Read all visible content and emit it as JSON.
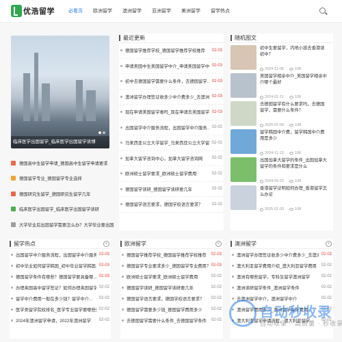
{
  "logo": {
    "text": "优浩留学"
  },
  "nav": [
    "必看页",
    "欧洲留学",
    "澳洲留学",
    "亚洲留学",
    "美洲留学",
    "留学热点"
  ],
  "hero": {
    "caption": "临床医学出国留学_临床医学出国留学读博"
  },
  "left_list": [
    {
      "text": "德国高中生留学申请_德国高中生留学申请要求",
      "color": "#e86a4a"
    },
    {
      "text": "德国留学专业_德国留学专业选择",
      "color": "#f2a43a"
    },
    {
      "text": "德国研究生留学_德国研究生留学几年",
      "color": "#e86a4a"
    },
    {
      "text": "临床医学出国留学_临床医学出国留学读研",
      "color": "#4caf50"
    },
    {
      "text": "大学毕业后出国留学需要怎么办？大学毕业要出国留学...",
      "color": "#9e9e9e"
    }
  ],
  "latest": {
    "title": "最近更新",
    "items": [
      {
        "text": "德国留学推荐学校_德国留学推荐学校推荐",
        "date": "02-03",
        "red": true
      },
      {
        "text": "申请美国中生美国留学中介_申请美国留学中介...",
        "date": "02-03",
        "red": true
      },
      {
        "text": "初中去德国留学需要什么条件，去德国留学...",
        "date": "02-03",
        "red": true
      },
      {
        "text": "澳洲留学办理签证收多少中介费多少_去澳洲...",
        "date": "02-03",
        "red": true
      },
      {
        "text": "现在申请美国留学难吗_现在申请去美国留学难...",
        "date": "02-03",
        "red": true
      },
      {
        "text": "出国留学中介服务流程，出国留学中介服务...",
        "date": "02-02",
        "red": false
      },
      {
        "text": "马来西亚公立大学留学_马来西亚公立大学留...",
        "date": "02-02",
        "red": false
      },
      {
        "text": "加拿大留学咨询中心，加拿大留学咨询网",
        "date": "02-02",
        "red": false
      },
      {
        "text": "欧洲硕士留学要求_欧洲硕士留学费用",
        "date": "02-02",
        "red": false
      },
      {
        "text": "德国留学读研_德国留学读研要几年",
        "date": "02-02",
        "red": false
      },
      {
        "text": "德国留学语言要求，德国学校语言要求？",
        "date": "02-02",
        "red": false
      }
    ]
  },
  "random": {
    "title": "随机图文",
    "items": [
      {
        "title": "初中生要留学，内地小孩去香港读初中？",
        "date": "2024-11-08",
        "views": "108",
        "color": "#d8c5b4"
      },
      {
        "title": "美国留学相亲中介_美国留学相亲中介哪个最好",
        "date": "2024-01-11",
        "views": "108",
        "color": "#b8c2cc"
      },
      {
        "title": "去德国留学有什么要求吗，去德国留学，需要什么条件？",
        "date": "2025-01-06",
        "views": "108",
        "color": "#cfd8c7"
      },
      {
        "title": "留学韩国中介费，留学韩国中介费用是多少",
        "date": "2024-11-13",
        "views": "108",
        "color": "#6fa8d9"
      },
      {
        "title": "出国加拿大留学的条件_出国加拿大留学的条件和要求是什么",
        "date": "2024-05-22",
        "views": "108",
        "color": "#7bbf6a"
      },
      {
        "title": "香港留学证明如何办理_香港留学怎么办证",
        "date": "2025-01-03",
        "views": "108",
        "color": "#c9d2dd"
      }
    ]
  },
  "bottom": [
    {
      "title": "留学热点",
      "items": [
        {
          "text": "出国留学中介服务流程，出国留学中介服务...",
          "date": "02-03",
          "red": true
        },
        {
          "text": "初中毕业如何留学韩国_初中毕业留学韩国...",
          "date": "02-03",
          "red": true
        },
        {
          "text": "德国留学条件有哪些？德国留学要具备哪...",
          "date": "02-03",
          "red": true
        },
        {
          "text": "办理英国高中留学签证？如何办理英国留学...",
          "date": "02-02",
          "red": false
        },
        {
          "text": "留学中介费用一般在多少钱？留学中介...",
          "date": "02-02",
          "red": false
        },
        {
          "text": "医学类留学院校排名_医学专业留学要哪些好",
          "date": "02-02",
          "red": false
        },
        {
          "text": "2024年澳洲留学申请，2022年澳洲留学",
          "date": "02-02",
          "red": false
        }
      ]
    },
    {
      "title": "欧洲留学",
      "items": [
        {
          "text": "德国留学推荐学校_德国留学推荐学校推荐",
          "date": "02-03",
          "red": true
        },
        {
          "text": "德国留学专业要求多少_德国留学专业费用？",
          "date": "02-03",
          "red": true
        },
        {
          "text": "欧洲硕士留学要求_欧洲硕士留学费用",
          "date": "02-02",
          "red": false
        },
        {
          "text": "德国留学读研_德国留学读研要几年",
          "date": "02-02",
          "red": false
        },
        {
          "text": "德国留学语言要求，德国学校语言要求？",
          "date": "02-02",
          "red": false
        },
        {
          "text": "德国留学需要多少钱_德国留学费用多少",
          "date": "02-02",
          "red": false
        },
        {
          "text": "去德国留学需要什么条件_去德国留学条件",
          "date": "02-02",
          "red": false
        }
      ]
    },
    {
      "title": "澳洲留学",
      "items": [
        {
          "text": "澳洲留学办理签证收多少中介费多少_去澳洲...",
          "date": "02-03",
          "red": true
        },
        {
          "text": "澳大利亚留学费用介绍_澳大利亚留学费用",
          "date": "02-02",
          "red": false
        },
        {
          "text": "澳洲有哪些留学，专科生留学澳洲留学",
          "date": "02-02",
          "red": false
        },
        {
          "text": "澳洲读研留学条件_澳洲留学条件",
          "date": "02-02",
          "red": false
        },
        {
          "text": "去澳洲留学中介，澳洲留学中介",
          "date": "02-02",
          "red": false
        },
        {
          "text": "澳洲留学费用多少_澳洲留学每年费用",
          "date": "02-02",
          "red": false
        },
        {
          "text": "澳大利亚留学申请流程，澳大利亚留学...",
          "date": "02-02",
          "red": false
        }
      ]
    }
  ],
  "watermark": {
    "brand": "自动秒收录",
    "sub": "自动收录 · 高质量 · 秒收录"
  }
}
